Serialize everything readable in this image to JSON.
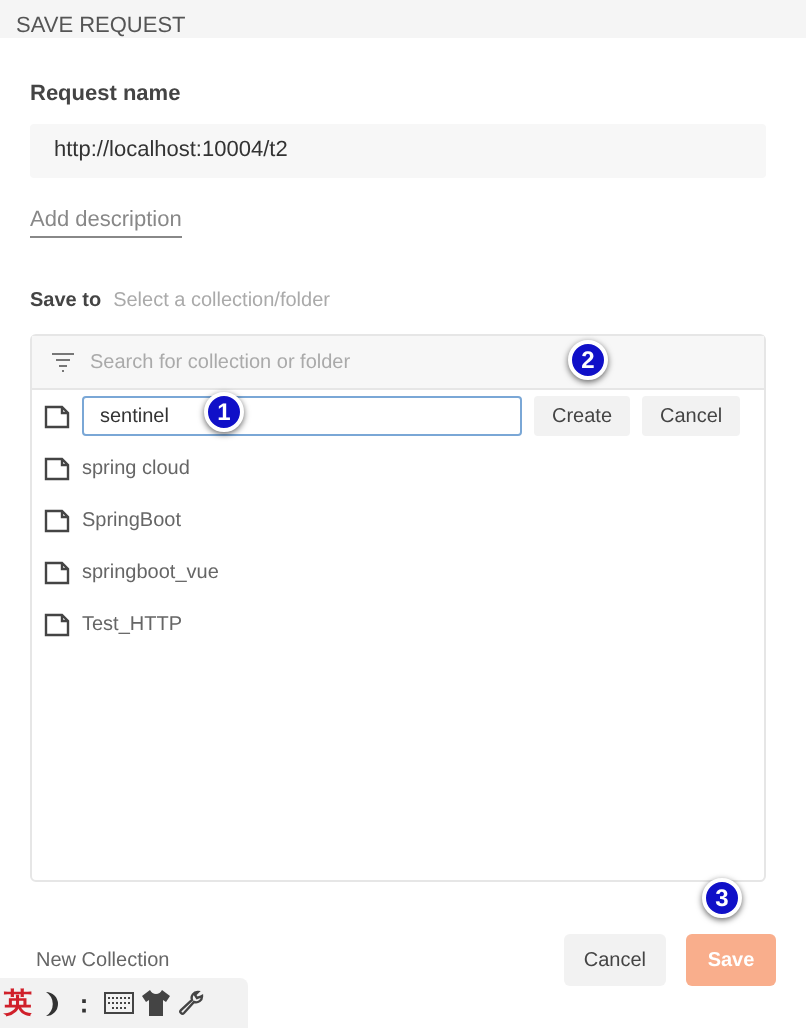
{
  "dialog": {
    "title": "SAVE REQUEST"
  },
  "request_name": {
    "label": "Request name",
    "value": "http://localhost:10004/t2"
  },
  "add_description": "Add description",
  "save_to": {
    "label": "Save to",
    "hint": "Select a collection/folder"
  },
  "search": {
    "placeholder": "Search for collection or folder"
  },
  "new_folder": {
    "value": "sentinel",
    "buttons": [
      "Create",
      "Cancel"
    ]
  },
  "collections": [
    "spring cloud",
    "SpringBoot",
    "springboot_vue",
    "Test_HTTP"
  ],
  "markers": [
    "1",
    "2",
    "3"
  ],
  "footer": {
    "new_collection": "New Collection",
    "cancel": "Cancel",
    "save": "Save",
    "save_disabled": true
  },
  "ime_bar": {
    "mode": "英",
    "punctuation": "："
  }
}
